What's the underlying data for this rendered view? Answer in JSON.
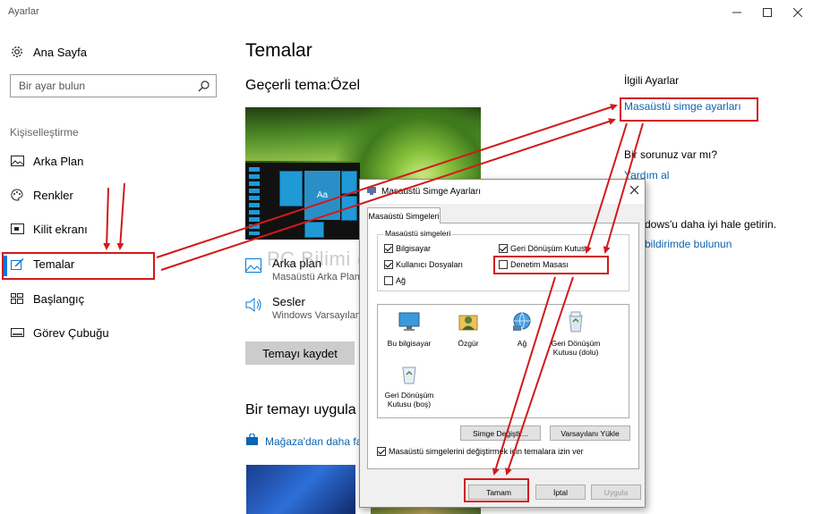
{
  "window": {
    "title": "Ayarlar",
    "minimize": "—",
    "maximize": "☐",
    "close": "✕"
  },
  "sidebar": {
    "home": "Ana Sayfa",
    "search_placeholder": "Bir ayar bulun",
    "section": "Kişiselleştirme",
    "items": [
      {
        "label": "Arka Plan",
        "icon": "picture-icon"
      },
      {
        "label": "Renkler",
        "icon": "palette-icon"
      },
      {
        "label": "Kilit ekranı",
        "icon": "lock-screen-icon"
      },
      {
        "label": "Temalar",
        "icon": "themes-icon",
        "active": true
      },
      {
        "label": "Başlangıç",
        "icon": "start-icon"
      },
      {
        "label": "Görev Çubuğu",
        "icon": "taskbar-icon"
      }
    ],
    "accent": "#0078d7"
  },
  "main": {
    "title": "Temalar",
    "current_theme": "Geçerli tema:Özel",
    "preview_tile": "Aa",
    "options": [
      {
        "title": "Arka plan",
        "value": "Masaüstü Arka Planı"
      },
      {
        "title": "Sesler",
        "value": "Windows Varsayılan"
      }
    ],
    "save_button": "Temayı kaydet",
    "apply_title": "Bir temayı uygula",
    "store_link": "Mağaza'dan daha fa"
  },
  "right": {
    "related": "İlgili Ayarlar",
    "desktop_icons_link": "Masaüstü simge ayarları",
    "question": "Bir sorunuz var mı?",
    "help_link": "Yardım al",
    "improve": "dows'u daha iyi hale getirin.",
    "feedback_link": "bildirimde bulunun",
    "link_color": "#0a64b0"
  },
  "watermark": "PC Bilimi @ pcbilimi.com",
  "dialog": {
    "title": "Masaüstü Simge Ayarları",
    "tab": "Masaüstü Simgeleri",
    "group_label": "Masaüstü simgeleri",
    "checkboxes": [
      {
        "label": "Bilgisayar",
        "checked": true
      },
      {
        "label": "Geri Dönüşüm Kutusu",
        "checked": true
      },
      {
        "label": "Kullanıcı Dosyaları",
        "checked": true
      },
      {
        "label": "Denetim Masası",
        "checked": false
      },
      {
        "label": "Ağ",
        "checked": false
      }
    ],
    "icons": [
      {
        "label": "Bu bilgisayar",
        "icon": "computer-icon"
      },
      {
        "label": "Özgür",
        "icon": "user-folder-icon"
      },
      {
        "label": "Ağ",
        "icon": "network-icon"
      },
      {
        "label": "Geri Dönüşüm Kutusu (dolu)",
        "icon": "recycle-bin-full-icon"
      },
      {
        "label": "Geri Dönüşüm Kutusu (boş)",
        "icon": "recycle-bin-empty-icon"
      }
    ],
    "change_icon_button": "Simge Değiştir...",
    "restore_default_button": "Varsayılanı Yükle",
    "allow_themes": "Masaüstü simgelerini değiştirmek için temalara izin ver",
    "allow_themes_checked": true,
    "ok_button": "Tamam",
    "cancel_button": "İptal",
    "apply_button": "Uygula"
  },
  "annotation_color": "#d11a1a"
}
